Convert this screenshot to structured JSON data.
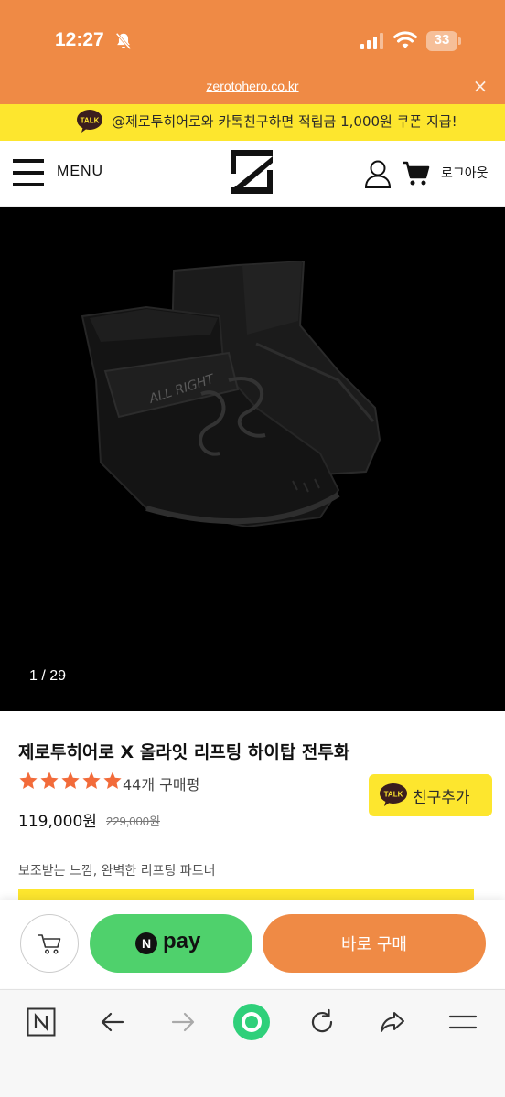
{
  "status_bar": {
    "time": "12:27",
    "battery": "33"
  },
  "browser": {
    "url": "zerotohero.co.kr",
    "close_glyph": "×"
  },
  "banner": {
    "badge": "TALK",
    "text": "@제로투히어로와 카톡친구하면 적립금 1,000원 쿠폰 지급!"
  },
  "header": {
    "menu_label": "MENU",
    "logout_label": "로그아웃",
    "icons": [
      "menu-icon",
      "logo",
      "user-icon",
      "cart-icon"
    ]
  },
  "gallery": {
    "counter": "1 / 29"
  },
  "product": {
    "title": "제로투히어로 X 올라잇 리프팅 하이탑 전투화",
    "rating_stars": 5,
    "review_count": "44개 구매평",
    "price": "119,000원",
    "original_price": "229,000원",
    "tagline": "보조받는 느낌, 완벽한 리프팅 파트너",
    "kakao_badge": "TALK",
    "kakao_label": "친구추가"
  },
  "purchase_bar": {
    "npay_mark": "N",
    "npay_label": "pay",
    "buy_label": "바로 구매"
  },
  "colors": {
    "accent_orange": "#ef8a45",
    "banner_yellow": "#fde62e",
    "npay_green": "#4fd16c",
    "star_orange": "#f26b3a"
  }
}
